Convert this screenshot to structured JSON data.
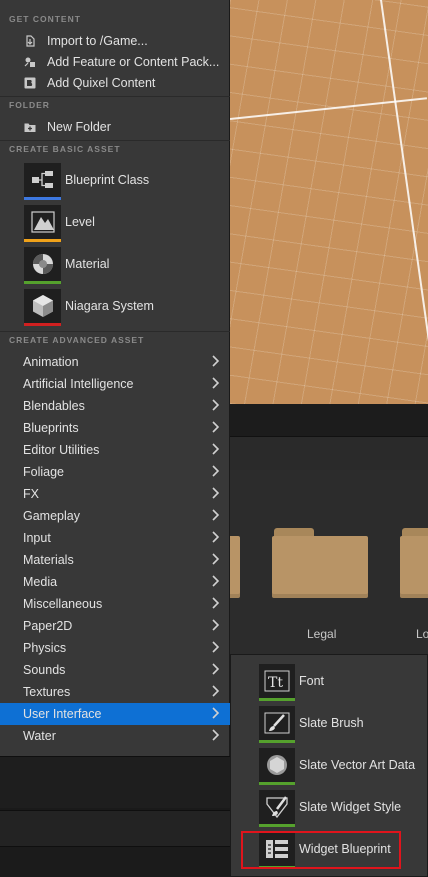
{
  "menu": {
    "get_content_header": "GET CONTENT",
    "get_content_items": [
      {
        "label": "Import to /Game...",
        "icon": "import-icon"
      },
      {
        "label": "Add Feature or Content Pack...",
        "icon": "feature-pack-icon"
      },
      {
        "label": "Add Quixel Content",
        "icon": "quixel-icon"
      }
    ],
    "folder_header": "FOLDER",
    "folder_items": [
      {
        "label": "New Folder",
        "icon": "new-folder-icon"
      }
    ],
    "basic_asset_header": "CREATE BASIC ASSET",
    "basic_assets": [
      {
        "label": "Blueprint Class",
        "icon": "blueprint-class-icon",
        "color": "#3d78e0"
      },
      {
        "label": "Level",
        "icon": "level-icon",
        "color": "#f0a21a"
      },
      {
        "label": "Material",
        "icon": "material-icon",
        "color": "#55a12d"
      },
      {
        "label": "Niagara System",
        "icon": "niagara-system-icon",
        "color": "#d12020"
      }
    ],
    "advanced_asset_header": "CREATE ADVANCED ASSET",
    "advanced_assets": [
      {
        "label": "Animation"
      },
      {
        "label": "Artificial Intelligence"
      },
      {
        "label": "Blendables"
      },
      {
        "label": "Blueprints"
      },
      {
        "label": "Editor Utilities"
      },
      {
        "label": "Foliage"
      },
      {
        "label": "FX"
      },
      {
        "label": "Gameplay"
      },
      {
        "label": "Input"
      },
      {
        "label": "Materials"
      },
      {
        "label": "Media"
      },
      {
        "label": "Miscellaneous"
      },
      {
        "label": "Paper2D"
      },
      {
        "label": "Physics"
      },
      {
        "label": "Sounds"
      },
      {
        "label": "Textures"
      },
      {
        "label": "User Interface",
        "active": true
      },
      {
        "label": "Water"
      }
    ],
    "active_color": "#0e70d4"
  },
  "submenu": {
    "items": [
      {
        "label": "Font",
        "icon": "font-icon"
      },
      {
        "label": "Slate Brush",
        "icon": "slate-brush-icon"
      },
      {
        "label": "Slate Vector Art Data",
        "icon": "slate-vector-art-icon"
      },
      {
        "label": "Slate Widget Style",
        "icon": "slate-widget-style-icon"
      },
      {
        "label": "Widget Blueprint",
        "icon": "widget-blueprint-icon",
        "highlighted": true
      }
    ],
    "highlight_color": "#e0141c"
  },
  "content_browser": {
    "folders": [
      {
        "label": "Legal"
      },
      {
        "label": "Lo"
      }
    ]
  }
}
